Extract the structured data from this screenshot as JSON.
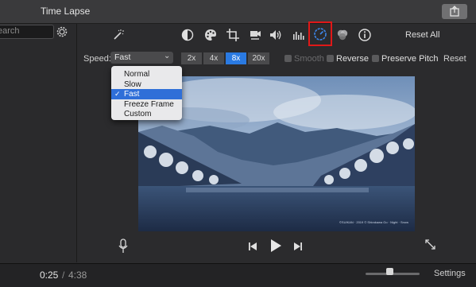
{
  "window": {
    "title": "Time Lapse"
  },
  "left_panel": {
    "search_placeholder": "earch"
  },
  "toolbar": {
    "tools": [
      "magic-wand",
      "color-balance",
      "color-correction",
      "crop",
      "stabilization",
      "volume",
      "equalizer",
      "speed",
      "video-overlay",
      "info"
    ],
    "reset_all_label": "Reset All"
  },
  "speed": {
    "label": "Speed:",
    "selected": "Fast",
    "multipliers": [
      {
        "label": "2x",
        "active": false
      },
      {
        "label": "4x",
        "active": false
      },
      {
        "label": "8x",
        "active": true
      },
      {
        "label": "20x",
        "active": false
      }
    ],
    "smooth_label": "Smooth",
    "reverse_label": "Reverse",
    "preserve_pitch_label": "Preserve Pitch",
    "reset_label": "Reset",
    "options": [
      {
        "label": "Normal",
        "selected": false
      },
      {
        "label": "Slow",
        "selected": false
      },
      {
        "label": "Fast",
        "selected": true
      },
      {
        "label": "Freeze Frame",
        "selected": false
      },
      {
        "label": "Custom",
        "selected": false
      }
    ]
  },
  "viewer": {
    "caption": "©SUIKAN · 2019 © Shirakawa Go · Night · Snow"
  },
  "timeline": {
    "current_time": "0:25",
    "separator": "/",
    "total_time": "4:38",
    "settings_label": "Settings",
    "zoom_level": 0.45
  },
  "colors": {
    "accent": "#2a7ae2",
    "highlight_box": "#e01818"
  }
}
